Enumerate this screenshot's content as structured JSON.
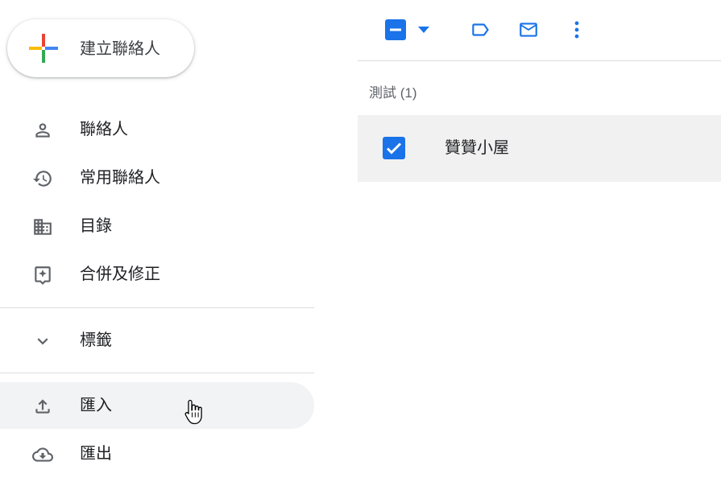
{
  "sidebar": {
    "create_button": {
      "label": "建立聯絡人"
    },
    "items": [
      {
        "label": "聯絡人",
        "icon": "person-icon"
      },
      {
        "label": "常用聯絡人",
        "icon": "history-icon"
      },
      {
        "label": "目錄",
        "icon": "domain-icon"
      },
      {
        "label": "合併及修正",
        "icon": "merge-fix-icon"
      }
    ],
    "labels_toggle": {
      "label": "標籤",
      "icon": "chevron-down-icon"
    },
    "actions": [
      {
        "label": "匯入",
        "icon": "upload-icon",
        "active": true
      },
      {
        "label": "匯出",
        "icon": "cloud-download-icon"
      }
    ]
  },
  "toolbar": {
    "select_state": "partial",
    "icons": [
      "select-all-checkbox-icon",
      "select-dropdown-icon",
      "label-icon",
      "mail-icon",
      "more-vert-icon"
    ]
  },
  "main": {
    "group_header": "測試 (1)",
    "rows": [
      {
        "name": "贊贊小屋",
        "checked": true
      }
    ]
  },
  "colors": {
    "accent": "#1a73e8",
    "icon_grey": "#5f6368",
    "active_bg": "#f1f3f4",
    "row_bg": "#f1f1f1",
    "divider": "#dadce0"
  }
}
